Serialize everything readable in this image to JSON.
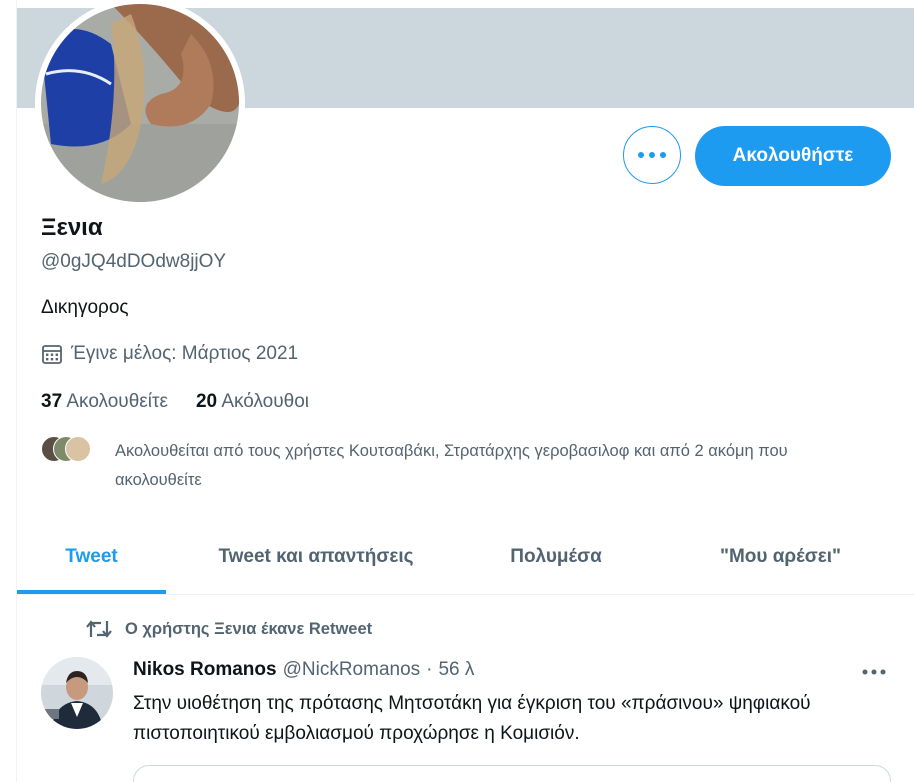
{
  "profile": {
    "name": "Ξενια",
    "handle": "@0gJQ4dDOdw8jjOY",
    "bio": "Δικηγορος",
    "joined": "Έγινε μέλος: Μάρτιος 2021",
    "following_count": "37",
    "following_label": "Ακολουθείτε",
    "followers_count": "20",
    "followers_label": "Ακόλουθοι",
    "followed_by_text": "Ακολουθείται από τους χρήστες Κουτσαβάκι, Στρατάρχης γεροβασιλοφ και από 2 ακόμη που ακολουθείτε"
  },
  "actions": {
    "more_icon": "more-horizontal-icon",
    "follow_label": "Ακολουθήστε"
  },
  "tabs": [
    {
      "label": "Tweet",
      "active": true
    },
    {
      "label": "Tweet και απαντήσεις",
      "active": false
    },
    {
      "label": "Πολυμέσα",
      "active": false
    },
    {
      "label": "\"Μου αρέσει\"",
      "active": false
    }
  ],
  "tweet": {
    "retweet_notice": "Ο χρήστης Ξενια έκανε Retweet",
    "author_name": "Nikos Romanos",
    "author_handle": "@NickRomanos",
    "separator": "·",
    "time": "56 λ",
    "text": "Στην υιοθέτηση της πρότασης Μητσοτάκη για έγκριση του «πράσινου» ψηφιακού πιστοποιητικού εμβολιασμού προχώρησε η Κομισιόν."
  },
  "colors": {
    "accent": "#1d9bf0",
    "banner": "#ccd6dd",
    "secondary_text": "#536471",
    "primary_text": "#0f1419"
  }
}
